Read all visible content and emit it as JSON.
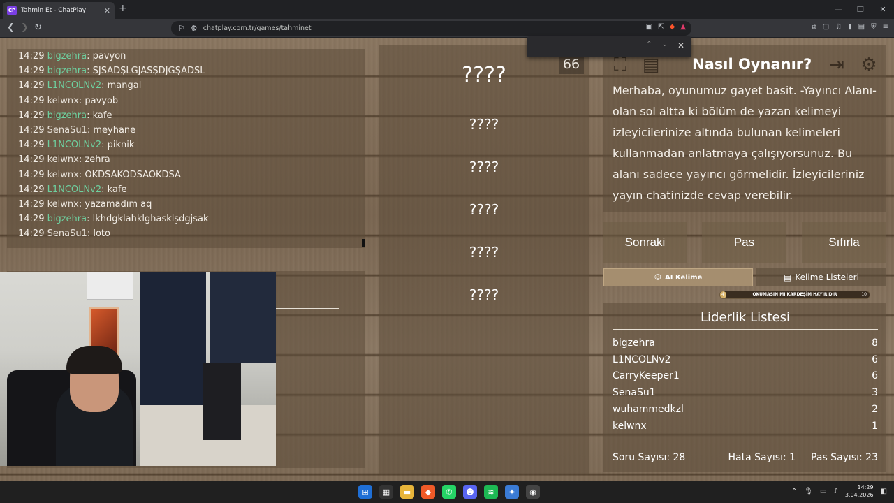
{
  "browser": {
    "tab_title": "Tahmin Et - ChatPlay",
    "tab_favicon": "CP",
    "url": "chatplay.com.tr/games/tahminet"
  },
  "chat": [
    {
      "time": "14:29",
      "user": "bigzehra",
      "color": "green",
      "msg": "pavyon"
    },
    {
      "time": "14:29",
      "user": "bigzehra",
      "color": "green",
      "msg": "ŞJSADŞLGJASŞDJGŞADSL"
    },
    {
      "time": "14:29",
      "user": "L1NCOLNv2",
      "color": "green",
      "msg": "mangal"
    },
    {
      "time": "14:29",
      "user": "kelwnx",
      "color": "white",
      "msg": "pavyob"
    },
    {
      "time": "14:29",
      "user": "bigzehra",
      "color": "green",
      "msg": "kafe"
    },
    {
      "time": "14:29",
      "user": "SenaSu1",
      "color": "white",
      "msg": "meyhane"
    },
    {
      "time": "14:29",
      "user": "L1NCOLNv2",
      "color": "green",
      "msg": "piknik"
    },
    {
      "time": "14:29",
      "user": "kelwnx",
      "color": "white",
      "msg": "zehra"
    },
    {
      "time": "14:29",
      "user": "kelwnx",
      "color": "white",
      "msg": "OKDSAKODSAOKDSA"
    },
    {
      "time": "14:29",
      "user": "L1NCOLNv2",
      "color": "green",
      "msg": "kafe"
    },
    {
      "time": "14:29",
      "user": "kelwnx",
      "color": "white",
      "msg": "yazamadım aq"
    },
    {
      "time": "14:29",
      "user": "bigzehra",
      "color": "green",
      "msg": "lkhdgklahklghasklşdgjsak"
    },
    {
      "time": "14:29",
      "user": "SenaSu1",
      "color": "white",
      "msg": "loto"
    }
  ],
  "words": {
    "main": "????",
    "forbidden": [
      "????",
      "????",
      "????",
      "????",
      "????"
    ]
  },
  "timer": "66",
  "howto": {
    "title": "Nasıl Oynanır?",
    "description": "Merhaba, oyunumuz gayet basit. -Yayıncı Alanı- olan sol altta ki bölüm de yazan kelimeyi izleyicilerinize altında bulunan kelimeleri kullanmadan anlatmaya çalışıyorsunuz. Bu alanı sadece yayıncı görmelidir. İzleyicileriniz yayın chatinizde cevap verebilir."
  },
  "actions": {
    "next": "Sonraki",
    "pass": "Pas",
    "reset": "Sıfırla",
    "ai_word": "AI Kelime",
    "word_lists": "Kelime Listeleri"
  },
  "progress": {
    "label": "OKUMASIN MI KARDEŞİM HAYIRIDIR",
    "start": "4",
    "end": "10",
    "fraction": 0.04
  },
  "leaderboard": {
    "title": "Liderlik Listesi",
    "rows": [
      {
        "name": "bigzehra",
        "score": "8"
      },
      {
        "name": "L1NCOLNv2",
        "score": "6"
      },
      {
        "name": "CarryKeeper1",
        "score": "6"
      },
      {
        "name": "SenaSu1",
        "score": "3"
      },
      {
        "name": "wuhammedkzl",
        "score": "2"
      },
      {
        "name": "kelwnx",
        "score": "1"
      }
    ],
    "questions": "Soru Sayısı: 28",
    "errors": "Hata Sayısı: 1",
    "passes": "Pas Sayısı: 23"
  },
  "taskbar": {
    "time": "14:29",
    "date": "3.04.2026"
  },
  "colors": {
    "username_green": "#6ed1a0",
    "ai_button": "#a58e6f"
  }
}
